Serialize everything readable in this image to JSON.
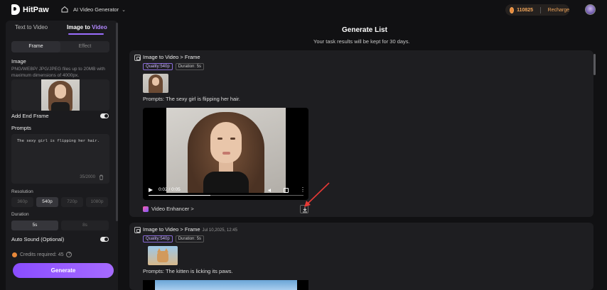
{
  "header": {
    "brand": "HitPaw",
    "nav_label": "AI Video Generator",
    "credits": "110825",
    "recharge": "Recharge"
  },
  "sidebar": {
    "tabs": [
      "Text to Video",
      "Image to Video"
    ],
    "active_tab": "Image to Video",
    "mode_tabs": [
      "Frame",
      "Effect"
    ],
    "image_label": "Image",
    "image_hint": "PNG/WEBP/ JPG/JPEG files up to 20MB with maximum dimensions of 4000px.",
    "end_frame_label": "Add End Frame",
    "end_frame_on": true,
    "prompts_label": "Prompts",
    "prompt_value": "The sexy girl is flipping her hair.",
    "prompt_counter": "35/2000",
    "resolution_label": "Resolution",
    "resolutions": [
      "360p",
      "540p",
      "720p",
      "1080p"
    ],
    "resolution_selected": "540p",
    "duration_label": "Duration",
    "durations": [
      "5s",
      "8s"
    ],
    "duration_selected": "5s",
    "auto_sound_label": "Auto Sound (Optional)",
    "auto_sound_on": true,
    "credits_required": "Credits required: 45",
    "generate_label": "Generate"
  },
  "main": {
    "title": "Generate List",
    "subtitle": "Your task results will be kept for 30 days.",
    "tasks": [
      {
        "title": "Image to Video > Frame",
        "date": "",
        "quality": "Quality:540p",
        "duration": "Duration: 5s",
        "prompt": "Prompts:  The sexy girl is flipping her hair.",
        "time": "0:02 / 0:05",
        "progress": 0.4,
        "enhancer": "Video Enhancer >"
      },
      {
        "title": "Image to Video > Frame",
        "date": "Jul 10,2025, 12:45",
        "quality": "Quality:540p",
        "duration": "Duration: 5s",
        "prompt": "Prompts:  The kitten is licking its paws."
      }
    ]
  },
  "colors": {
    "accent": "#9b6dff",
    "credit": "#f2a65a",
    "annotation_arrow": "#e53935"
  }
}
